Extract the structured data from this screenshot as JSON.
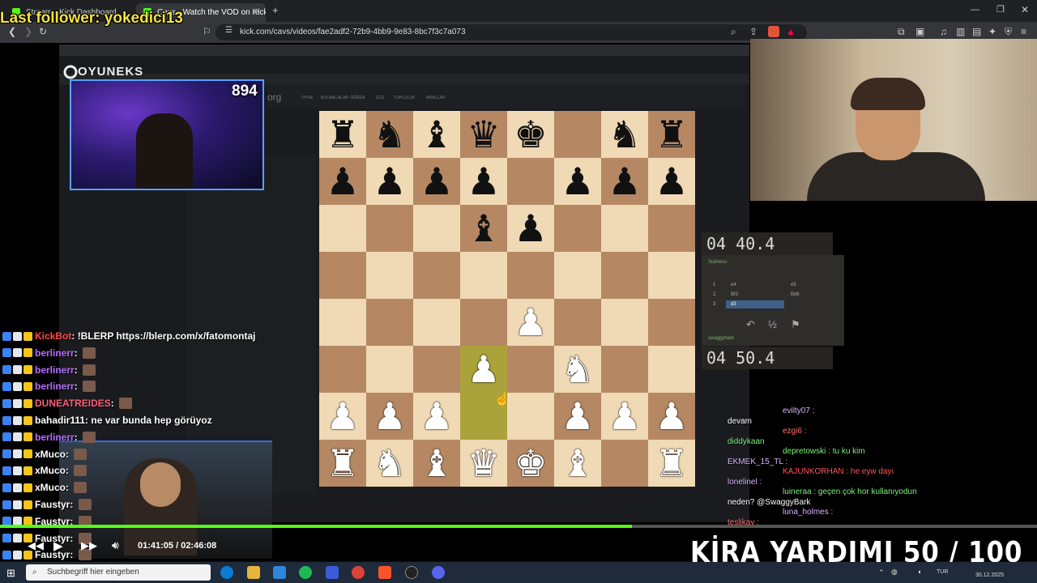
{
  "browser": {
    "tabs": [
      {
        "label": "Stream - Kick Dashboard"
      },
      {
        "label": "Cavs - Watch the VOD on Kick"
      }
    ],
    "new_tab": "+",
    "url": "kick.com/cavs/videos/fae2adf2-72b9-4bb9-9e83-8bc7f3c7a073"
  },
  "overlay": {
    "last_follower": "Last follower: yokedici13",
    "viewer_count": "894",
    "brand": "OYUNEKS",
    "goal_text": "KİRA YARDIMI 50 / 100"
  },
  "inner_site": {
    "logo": "org",
    "nav": [
      "OYNA",
      "BULMACALAR",
      "ÖĞREN",
      "İZLE",
      "TOPLULUK",
      "ARAÇLAR"
    ],
    "top_clock": "04 40.4",
    "bottom_clock": "04 50.4",
    "top_player": "Subness",
    "bottom_player": "swaggybark",
    "moves": [
      [
        "1",
        "e4",
        "e5"
      ],
      [
        "2",
        "Bf3",
        "Bd6"
      ],
      [
        "3",
        "d3",
        ""
      ]
    ],
    "actions": [
      "↶",
      "½",
      "⚑"
    ]
  },
  "board": {
    "rows": [
      [
        "bR",
        "bN",
        "bB",
        "bQ",
        "bK",
        "",
        "bN",
        "bR"
      ],
      [
        "bP",
        "bP",
        "bP",
        "bP",
        "",
        "bP",
        "bP",
        "bP"
      ],
      [
        "",
        "",
        "",
        "bB",
        "bP",
        "",
        "",
        ""
      ],
      [
        "",
        "",
        "",
        "",
        "",
        "",
        "",
        ""
      ],
      [
        "",
        "",
        "",
        "",
        "wP",
        "",
        "",
        ""
      ],
      [
        "",
        "",
        "",
        "wP",
        "",
        "wN",
        "",
        ""
      ],
      [
        "wP",
        "wP",
        "wP",
        "",
        "",
        "wP",
        "wP",
        "wP"
      ],
      [
        "wR",
        "wN",
        "wB",
        "wQ",
        "wK",
        "wB",
        "",
        "wR"
      ]
    ],
    "light_color": "#f0d9b5",
    "dark_color": "#b58863",
    "highlight_squares": [
      [
        5,
        3
      ],
      [
        6,
        3
      ]
    ],
    "highlight_color": "#aaa23a"
  },
  "chat": [
    {
      "user": "KickBot",
      "color": "#ff4a4a",
      "text": "!BLERP https://blerp.com/x/fatomontaj",
      "emote": false
    },
    {
      "user": "berlinerr",
      "color": "#b66cff",
      "text": "",
      "emote": true
    },
    {
      "user": "berlinerr",
      "color": "#b66cff",
      "text": "",
      "emote": true
    },
    {
      "user": "berlinerr",
      "color": "#b66cff",
      "text": "",
      "emote": true
    },
    {
      "user": "DUNEATREIDES",
      "color": "#ff5e7a",
      "text": "",
      "emote": true
    },
    {
      "user": "bahadir111",
      "color": "#ffffff",
      "text": "ne var bunda hep görüyoz",
      "emote": false
    },
    {
      "user": "berlinerr",
      "color": "#b66cff",
      "text": "",
      "emote": true
    },
    {
      "user": "xMuco",
      "color": "#ffffff",
      "text": "",
      "emote": true
    },
    {
      "user": "xMuco",
      "color": "#ffffff",
      "text": "",
      "emote": true
    },
    {
      "user": "xMuco",
      "color": "#ffffff",
      "text": "",
      "emote": true
    },
    {
      "user": "Faustyr",
      "color": "#ffffff",
      "text": "",
      "emote": true
    },
    {
      "user": "Faustyr",
      "color": "#ffffff",
      "text": "",
      "emote": true
    },
    {
      "user": "Faustyr",
      "color": "#ffffff",
      "text": "",
      "emote": true
    },
    {
      "user": "Faustyr",
      "color": "#ffffff",
      "text": "",
      "emote": true
    }
  ],
  "inner_chat": [
    {
      "text": "evilty07 :",
      "color": "#d8b4ff"
    },
    {
      "text": "devam",
      "color": "#ffffff"
    },
    {
      "text": "ezgi6 :",
      "color": "#ff7070"
    },
    {
      "text": "diddykaan",
      "color": "#7df07d"
    },
    {
      "text": "depretowski : tu ku kim",
      "color": "#7df07d"
    },
    {
      "text": "EKMEK_15_TL :",
      "color": "#d8b4ff"
    },
    {
      "text": "KAJUNKORHAN : he eyw dayı",
      "color": "#ff5555"
    },
    {
      "text": "lonelinel :",
      "color": "#d8b4ff"
    },
    {
      "text": "luineraa : geçen çok hor kullanıyodun",
      "color": "#7df07d"
    },
    {
      "text": "neden? @SwaggyBark",
      "color": "#ffffff"
    },
    {
      "text": "luna_holmes :",
      "color": "#d8b4ff"
    },
    {
      "text": "teslikay :",
      "color": "#ff7070"
    }
  ],
  "player": {
    "time": "01:41:05 / 02:46:08",
    "progress": 0.609
  },
  "taskbar": {
    "search_placeholder": "Suchbegriff hier eingeben",
    "lang": "TUR",
    "date": "30.12.2025"
  }
}
